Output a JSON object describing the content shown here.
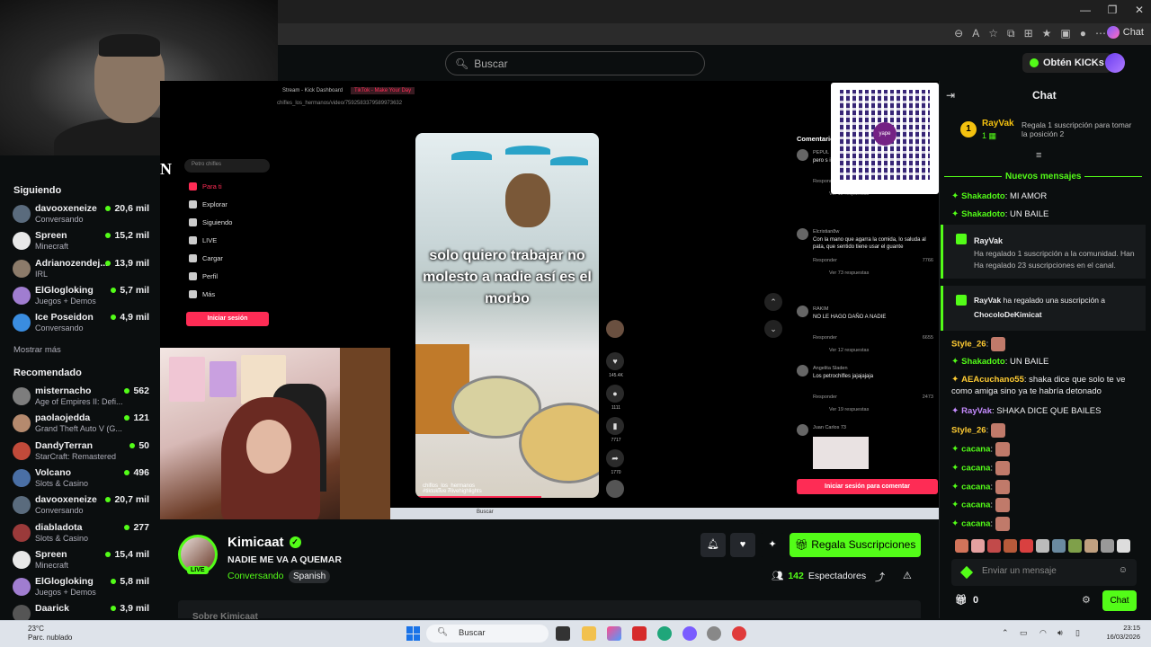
{
  "browser": {
    "chat_label": "Chat"
  },
  "header": {
    "search_placeholder": "Buscar",
    "kicks_label": "Obtén KICKs"
  },
  "sidebar": {
    "following_title": "Siguiendo",
    "following": [
      {
        "name": "davooxeneize",
        "category": "Conversando",
        "viewers": "20,6 mil",
        "color": "#5a6b7d"
      },
      {
        "name": "Spreen",
        "category": "Minecraft",
        "viewers": "15,2 mil",
        "color": "#e8e8e8"
      },
      {
        "name": "Adrianozendej...",
        "category": "IRL",
        "viewers": "13,9 mil",
        "color": "#8c7b6a"
      },
      {
        "name": "ElGlogloking",
        "category": "Juegos + Demos",
        "viewers": "5,7 mil",
        "color": "#a07dd0"
      },
      {
        "name": "Ice Poseidon",
        "category": "Conversando",
        "viewers": "4,9 mil",
        "color": "#3a8de0"
      }
    ],
    "show_more": "Mostrar más",
    "recommended_title": "Recomendado",
    "recommended": [
      {
        "name": "misternacho",
        "category": "Age of Empires II: Defi...",
        "viewers": "562",
        "color": "#7d7d7d"
      },
      {
        "name": "paolaojedda",
        "category": "Grand Theft Auto V (G...",
        "viewers": "121",
        "color": "#b58a6e"
      },
      {
        "name": "DandyTerran",
        "category": "StarCraft: Remastered",
        "viewers": "50",
        "color": "#c14a3a"
      },
      {
        "name": "Volcano",
        "category": "Slots & Casino",
        "viewers": "496",
        "color": "#4a6fa5"
      },
      {
        "name": "davooxeneize",
        "category": "Conversando",
        "viewers": "20,7 mil",
        "color": "#5a6b7d"
      },
      {
        "name": "diabladota",
        "category": "Slots & Casino",
        "viewers": "277",
        "color": "#9a3a3a"
      },
      {
        "name": "Spreen",
        "category": "Minecraft",
        "viewers": "15,4 mil",
        "color": "#e8e8e8"
      },
      {
        "name": "ElGlogloking",
        "category": "Juegos + Demos",
        "viewers": "5,8 mil",
        "color": "#a07dd0"
      },
      {
        "name": "Daarick",
        "category": "",
        "viewers": "3,9 mil",
        "color": "#555"
      }
    ]
  },
  "tiktok": {
    "tabs": [
      "Stream - Kick Dashboard",
      "TikTok - Make Your Day"
    ],
    "url": "chifles_los_hermanos/video/7592583379589973632",
    "search_placeholder": "Petro chifles",
    "nav": [
      "Para ti",
      "Explorar",
      "Siguiendo",
      "LIVE",
      "Cargar",
      "Perfil",
      "Más"
    ],
    "login_label": "Iniciar sesión",
    "video_caption": "solo quiero trabajar no molesto a nadie así es el morbo",
    "video_hashtags": "#tiktoklive #livehighlights",
    "video_user": "chiflos_los_hermanos",
    "action_counts": [
      "145.4K",
      "1111",
      "7717",
      "1770"
    ],
    "comments_title": "Comentarios",
    "comments": [
      {
        "user": "PEPUL",
        "text": "pero s intere incom",
        "likes": "",
        "replies": "Ver 12 respuestas"
      },
      {
        "user": "Elcristian8w",
        "text": "Con la mano que agarra la comida, lo saluda al pata, que sentido tiene usar el guante",
        "likes": "7766",
        "replies": "Ver 73 respuestas"
      },
      {
        "user": "RAKIM",
        "text": "NO LE HAGO DAÑO A NADIE",
        "likes": "6655",
        "replies": "Ver 12 respuestas"
      },
      {
        "user": "Angelita Sladen",
        "text": "Los petrochifles jajajajaja",
        "likes": "2473",
        "replies": "Ver 19 respuestas"
      },
      {
        "user": "Juan Carlos 73",
        "text": "",
        "likes": "",
        "replies": ""
      }
    ],
    "comment_reply": "Responder",
    "comment_login": "Iniciar sesión para comentar",
    "taskbar_search": "Buscar",
    "qr_label": "yape"
  },
  "stream": {
    "streamer": "Kimicaat",
    "live_label": "LIVE",
    "title": "NADIE ME VA A QUEMAR",
    "category": "Conversando",
    "language": "Spanish",
    "subscribe_label": "Regala Suscripciones",
    "viewers_count": "142",
    "viewers_label": "Espectadores",
    "about_label": "Sobre Kimicaat"
  },
  "chat": {
    "title": "Chat",
    "pinned_user": "RayVak",
    "pinned_rank": "1",
    "pinned_gift_text": "Regala 1 suscripción para tomar la posición 2",
    "new_messages": "Nuevos mensajes",
    "messages": [
      {
        "user": "Shakadoto",
        "text": "MI AMOR",
        "color": "#53fc18"
      },
      {
        "user": "Shakadoto",
        "text": "UN BAILE",
        "color": "#53fc18"
      }
    ],
    "gift1": {
      "user": "RayVak",
      "line1": "Ha regalado 1 suscripción a la comunidad. Han",
      "line2": "Ha regalado 23 suscripciones en el canal."
    },
    "gift2": {
      "user": "RayVak",
      "text": "ha regalado una suscripción a",
      "recipient": "ChocoloDeKimicat"
    },
    "messages2": [
      {
        "user": "Style_26",
        "text": "",
        "color": "#ffcc33",
        "emote": true
      },
      {
        "user": "Shakadoto",
        "text": "UN BAILE",
        "color": "#53fc18"
      },
      {
        "user": "AEAcuchano55",
        "text": "shaka dice que solo te ve como amiga sino ya te habría detonado",
        "color": "#ffcc33"
      },
      {
        "user": "RayVak",
        "text": "SHAKA DICE QUE BAILES",
        "color": "#c58cff"
      },
      {
        "user": "Style_26",
        "text": "",
        "color": "#ffcc33",
        "emote": true
      },
      {
        "user": "cacana",
        "text": "",
        "color": "#53fc18",
        "emote": true
      },
      {
        "user": "cacana",
        "text": "",
        "color": "#53fc18",
        "emote": true
      },
      {
        "user": "cacana",
        "text": "",
        "color": "#53fc18",
        "emote": true
      },
      {
        "user": "cacana",
        "text": "",
        "color": "#53fc18",
        "emote": true
      },
      {
        "user": "cacana",
        "text": "",
        "color": "#53fc18",
        "emote": true
      }
    ],
    "input_placeholder": "Enviar un mensaje",
    "points": "0",
    "send_label": "Chat"
  },
  "taskbar": {
    "weather_temp": "23°C",
    "weather_desc": "Parc. nublado",
    "search_label": "Buscar",
    "time": "23:15",
    "date": "16/03/2026"
  },
  "colors": {
    "accent": "#53fc18",
    "tiktok": "#fe2c55",
    "bg": "#0b0e0f"
  }
}
